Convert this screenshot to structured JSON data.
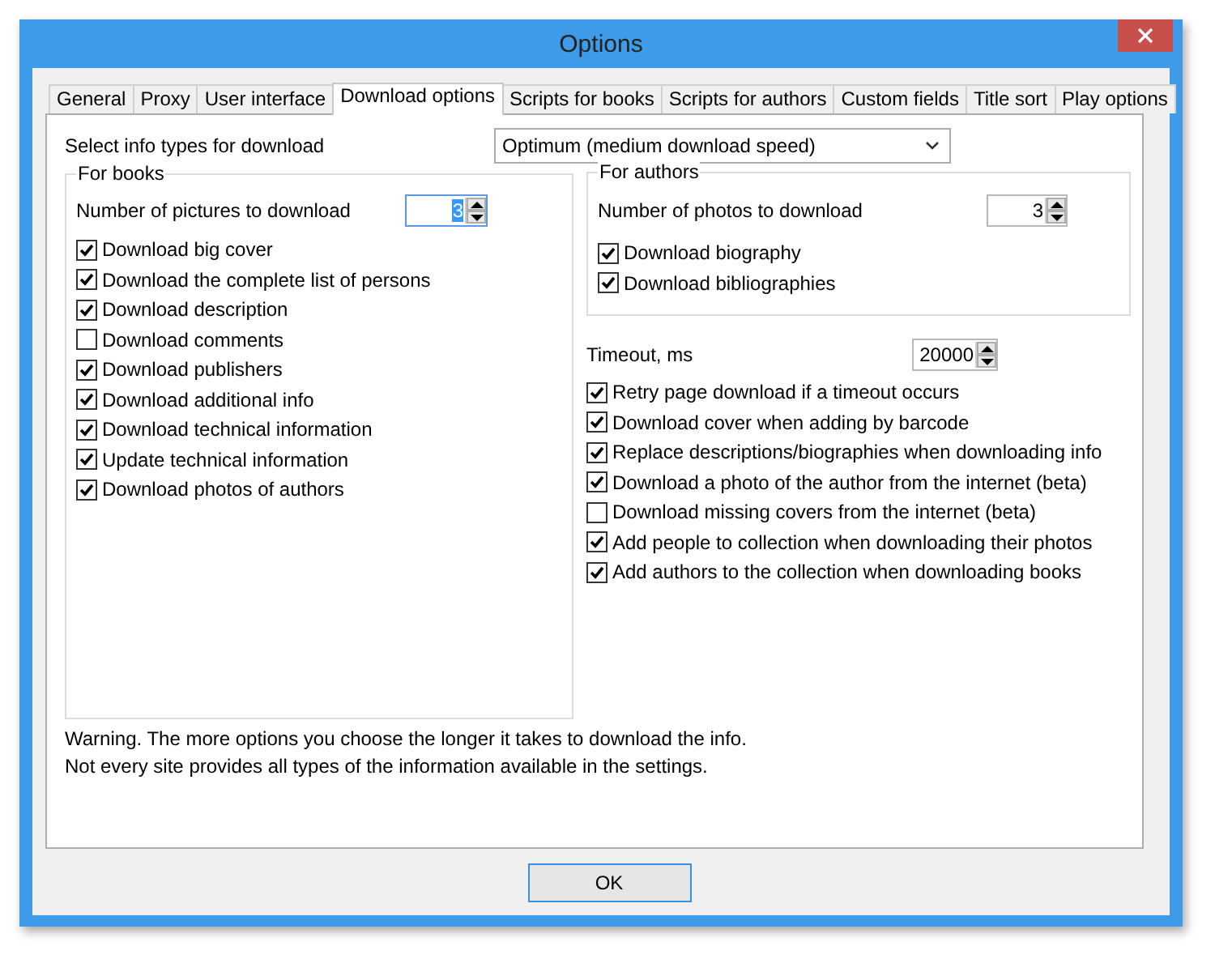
{
  "window": {
    "title": "Options"
  },
  "tabs": [
    {
      "label": "General",
      "selected": false
    },
    {
      "label": "Proxy",
      "selected": false
    },
    {
      "label": "User interface",
      "selected": false
    },
    {
      "label": "Download options",
      "selected": true
    },
    {
      "label": "Scripts for books",
      "selected": false
    },
    {
      "label": "Scripts for authors",
      "selected": false
    },
    {
      "label": "Custom fields",
      "selected": false
    },
    {
      "label": "Title sort",
      "selected": false
    },
    {
      "label": "Play options",
      "selected": false
    }
  ],
  "info_types": {
    "label": "Select info types for download",
    "value": "Optimum (medium download speed)"
  },
  "for_books": {
    "title": "For books",
    "count_label": "Number of pictures to download",
    "count_value": "3",
    "focused": true,
    "options": [
      {
        "label": "Download big cover",
        "checked": true
      },
      {
        "label": "Download the complete list of persons",
        "checked": true
      },
      {
        "label": "Download description",
        "checked": true
      },
      {
        "label": "Download comments",
        "checked": false
      },
      {
        "label": "Download publishers",
        "checked": true
      },
      {
        "label": "Download additional info",
        "checked": true
      },
      {
        "label": "Download technical information",
        "checked": true
      },
      {
        "label": "Update technical information",
        "checked": true
      },
      {
        "label": "Download photos of authors",
        "checked": true
      }
    ]
  },
  "for_authors": {
    "title": "For authors",
    "count_label": "Number of photos to download",
    "count_value": "3",
    "focused": false,
    "options": [
      {
        "label": "Download biography",
        "checked": true
      },
      {
        "label": "Download bibliographies",
        "checked": true
      }
    ]
  },
  "timeout": {
    "label": "Timeout, ms",
    "value": "20000",
    "focused": false
  },
  "general_options": [
    {
      "label": "Retry page download if a timeout occurs",
      "checked": true
    },
    {
      "label": "Download cover when adding by barcode",
      "checked": true
    },
    {
      "label": "Replace descriptions/biographies when downloading info",
      "checked": true
    },
    {
      "label": "Download a photo of the author from the internet (beta)",
      "checked": true
    },
    {
      "label": "Download missing covers from the internet (beta)",
      "checked": false
    },
    {
      "label": "Add people to collection when downloading their photos",
      "checked": true
    },
    {
      "label": "Add authors to the collection when downloading books",
      "checked": true
    }
  ],
  "notes": [
    "Warning. The more options you choose the longer it takes to download the info.",
    "Not every site provides all types of the information available in the settings."
  ],
  "buttons": [
    "OK"
  ]
}
